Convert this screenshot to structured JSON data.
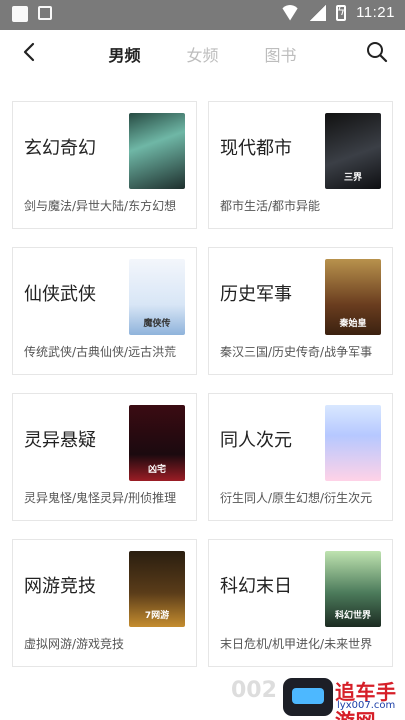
{
  "statusbar": {
    "time": "11:21",
    "icons": [
      "photo-icon",
      "gallery-icon",
      "wifi-icon",
      "signal-icon",
      "battery-charging-icon"
    ]
  },
  "nav": {
    "tabs": [
      {
        "label": "男频",
        "active": true
      },
      {
        "label": "女频",
        "active": false
      },
      {
        "label": "图书",
        "active": false
      }
    ],
    "icons": [
      "back-icon",
      "search-icon"
    ]
  },
  "categories": [
    {
      "title": "玄幻奇幻",
      "subtitle": "剑与魔法/异世大陆/东方幻想",
      "cover_text": ""
    },
    {
      "title": "现代都市",
      "subtitle": "都市生活/都市异能",
      "cover_text": "三界"
    },
    {
      "title": "仙侠武侠",
      "subtitle": "传统武侠/古典仙侠/远古洪荒",
      "cover_text": "魔侠传"
    },
    {
      "title": "历史军事",
      "subtitle": "秦汉三国/历史传奇/战争军事",
      "cover_text": "秦始皇"
    },
    {
      "title": "灵异悬疑",
      "subtitle": "灵异鬼怪/鬼怪灵异/刑侦推理",
      "cover_text": "凶宅"
    },
    {
      "title": "同人次元",
      "subtitle": "衍生同人/原生幻想/衍生次元",
      "cover_text": ""
    },
    {
      "title": "网游竞技",
      "subtitle": "虚拟网游/游戏竞技",
      "cover_text": "7网游"
    },
    {
      "title": "科幻末日",
      "subtitle": "末日危机/机甲进化/未来世界",
      "cover_text": "科幻世界"
    }
  ],
  "watermark": {
    "ghost_text": "002",
    "brand_text": "追车手游网",
    "url": "lyx007.com"
  }
}
